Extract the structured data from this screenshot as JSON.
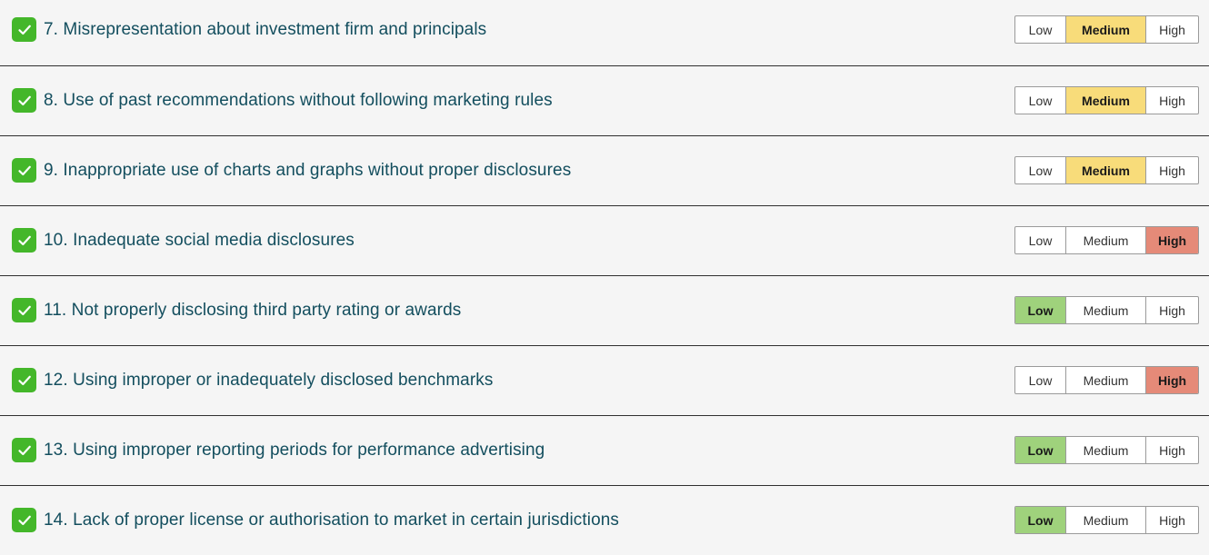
{
  "colors": {
    "check": "#44b72a",
    "text": "#134e5e",
    "low_selected": "#9fd27c",
    "medium_selected": "#f8dc7a",
    "high_selected": "#e58a78"
  },
  "icons": {
    "checkbox": "checkmark-icon"
  },
  "risk_labels": {
    "low": "Low",
    "medium": "Medium",
    "high": "High"
  },
  "items": [
    {
      "label": "7. Misrepresentation about investment firm and principals",
      "checked": true,
      "selected": "medium"
    },
    {
      "label": "8. Use of past recommendations without following marketing rules",
      "checked": true,
      "selected": "medium"
    },
    {
      "label": "9. Inappropriate use of charts and graphs without proper disclosures",
      "checked": true,
      "selected": "medium"
    },
    {
      "label": "10. Inadequate social media disclosures",
      "checked": true,
      "selected": "high"
    },
    {
      "label": "11. Not properly disclosing third party rating or awards",
      "checked": true,
      "selected": "low"
    },
    {
      "label": "12. Using improper or inadequately disclosed benchmarks",
      "checked": true,
      "selected": "high"
    },
    {
      "label": "13. Using improper reporting periods for performance advertising",
      "checked": true,
      "selected": "low"
    },
    {
      "label": "14. Lack of proper license or authorisation to market in certain jurisdictions",
      "checked": true,
      "selected": "low"
    }
  ]
}
